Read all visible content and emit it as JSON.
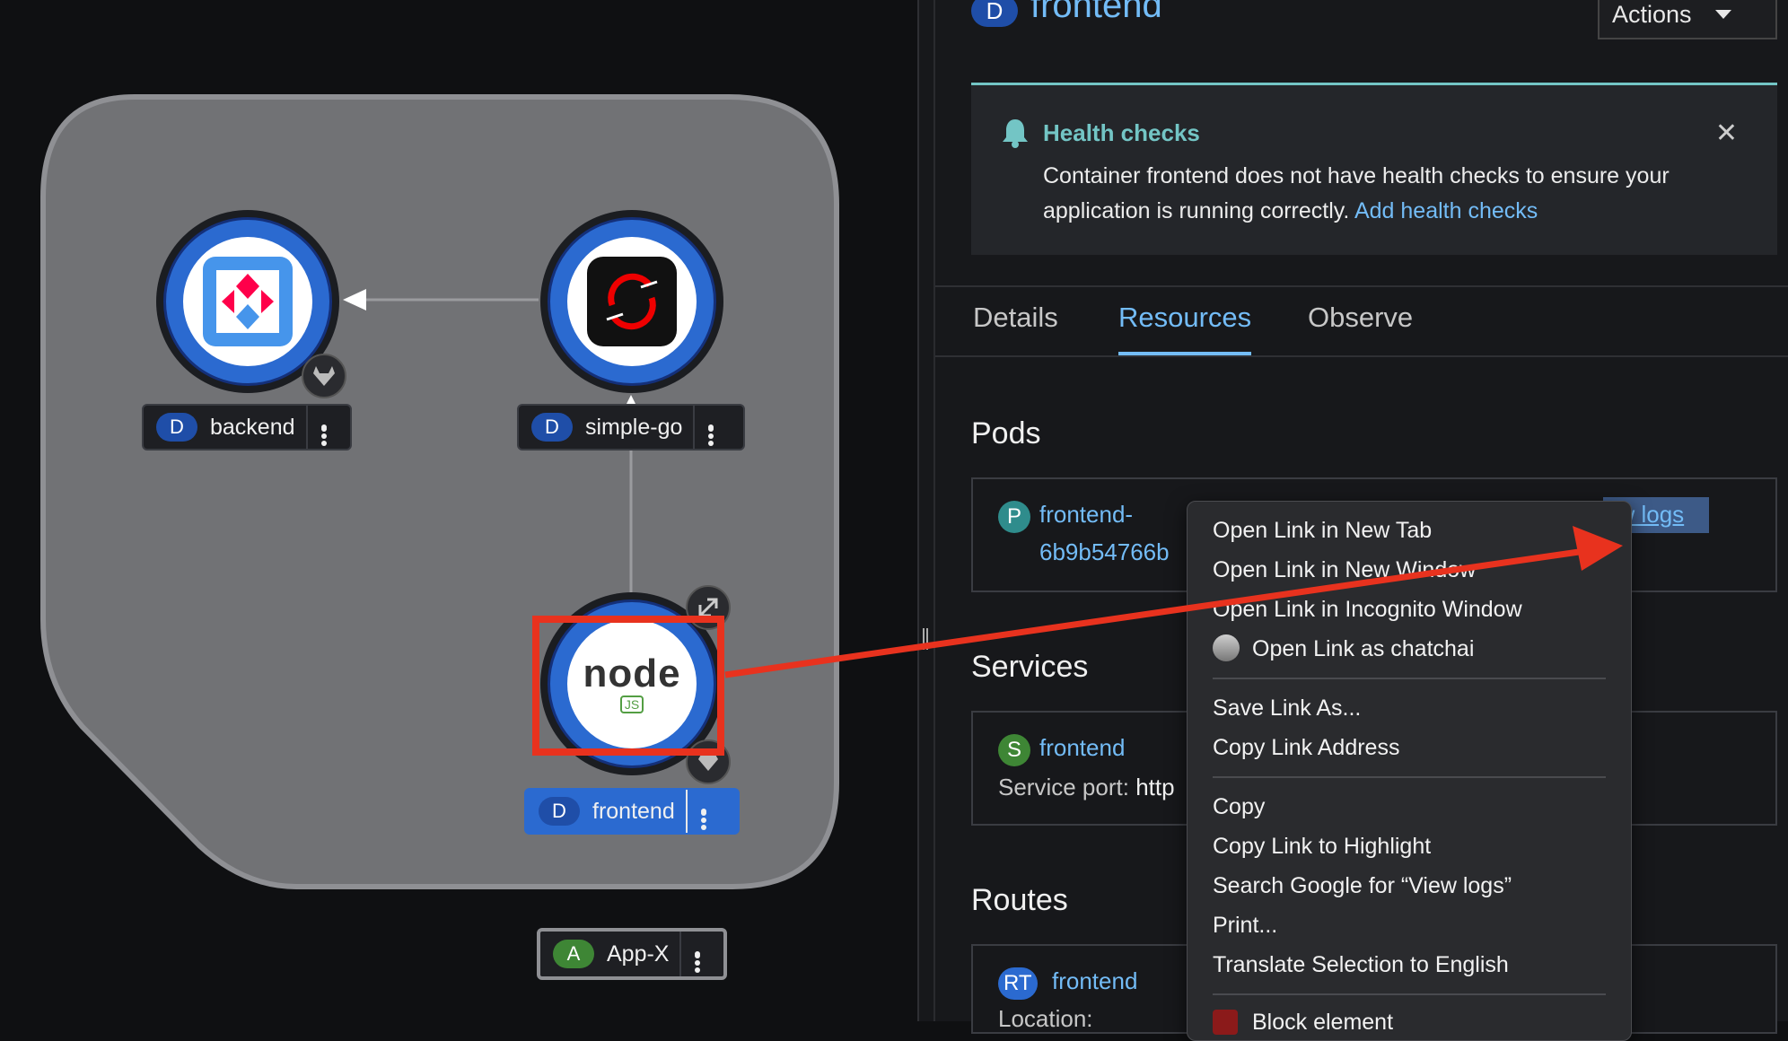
{
  "topology": {
    "nodes": [
      {
        "name": "backend",
        "kind_badge": "D"
      },
      {
        "name": "simple-go",
        "kind_badge": "D"
      },
      {
        "name": "frontend",
        "kind_badge": "D"
      }
    ],
    "application_group": {
      "name": "App-X",
      "kind_badge": "A"
    },
    "nodejs_logo_text": "node",
    "nodejs_logo_sub": "JS"
  },
  "panel": {
    "kind_badge": "D",
    "title": "frontend",
    "actions_label": "Actions",
    "alert": {
      "title": "Health checks",
      "text": "Container frontend does not have health checks to ensure your application is running correctly.",
      "link": "Add health checks"
    },
    "tabs": [
      "Details",
      "Resources",
      "Observe"
    ],
    "active_tab": "Resources",
    "pods": {
      "title": "Pods",
      "badge": "P",
      "name_line1": "frontend-",
      "name_line2": "6b9b54766b",
      "view_logs_partial": "ew logs"
    },
    "services": {
      "title": "Services",
      "badge": "S",
      "name": "frontend",
      "port_label": "Service port:",
      "port_value_partial": "http"
    },
    "routes": {
      "title": "Routes",
      "badge": "RT",
      "name": "frontend",
      "location_label_partial": "Location:"
    }
  },
  "context_menu": {
    "items": [
      "Open Link in New Tab",
      "Open Link in New Window",
      "Open Link in Incognito Window",
      "Open Link as chatchai",
      "Save Link As...",
      "Copy Link Address",
      "Copy",
      "Copy Link to Highlight",
      "Search Google for “View logs”",
      "Print...",
      "Translate Selection to English",
      "Block element"
    ]
  },
  "colors": {
    "accent_blue": "#73bcf7",
    "node_blue": "#2b6ad0",
    "annotation_red": "#e8321e",
    "alert_teal": "#73c5c5"
  }
}
